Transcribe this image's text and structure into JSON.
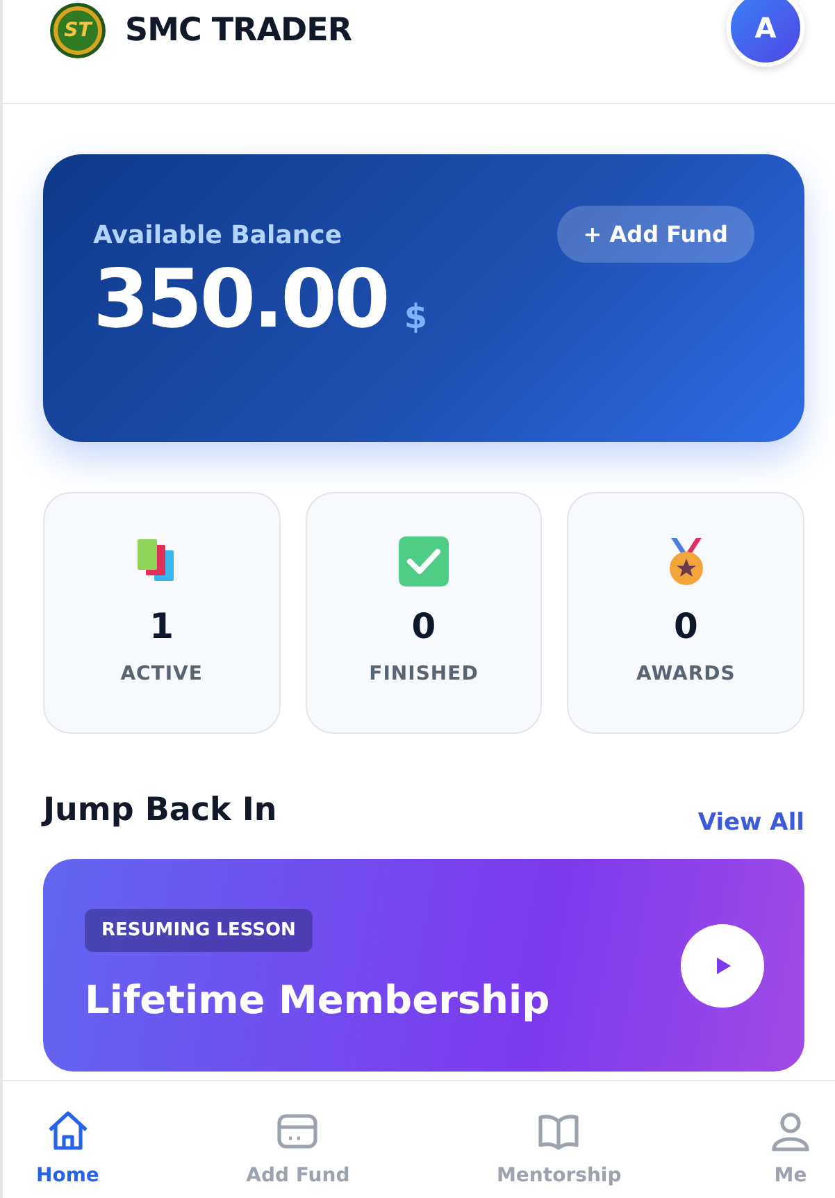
{
  "header": {
    "app_name": "SMC TRADER",
    "logo_text": "ST",
    "avatar": "A"
  },
  "balance": {
    "label": "Available Balance",
    "amount": "350.00",
    "currency": "$",
    "add_button": "+ Add Fund"
  },
  "stats": [
    {
      "kind": "books",
      "value": "1",
      "label": "ACTIVE"
    },
    {
      "kind": "check",
      "value": "0",
      "label": "FINISHED"
    },
    {
      "kind": "medal",
      "value": "0",
      "label": "AWARDS"
    }
  ],
  "section": {
    "title": "Jump Back In",
    "link": "View All"
  },
  "lesson": {
    "badge": "RESUMING LESSON",
    "title": "Lifetime Membership"
  },
  "nav": [
    {
      "kind": "home",
      "label": "Home",
      "selected": true
    },
    {
      "kind": "card",
      "label": "Add Fund",
      "selected": false
    },
    {
      "kind": "book",
      "label": "Mentorship",
      "selected": false
    },
    {
      "kind": "user",
      "label": "Me",
      "selected": false
    }
  ]
}
